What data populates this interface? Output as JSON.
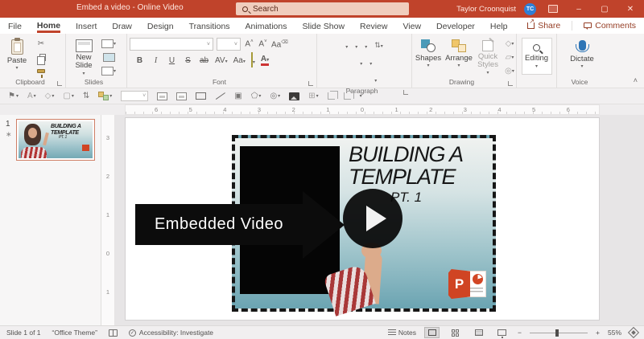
{
  "titlebar": {
    "title": "Embed a video - Online Video",
    "search_label": "Search",
    "user_name": "Taylor Croonquist",
    "user_initials": "TC"
  },
  "tabs": {
    "items": [
      "File",
      "Home",
      "Insert",
      "Draw",
      "Design",
      "Transitions",
      "Animations",
      "Slide Show",
      "Review",
      "View",
      "Developer",
      "Help"
    ],
    "active": "Home",
    "share": "Share",
    "comments": "Comments"
  },
  "ribbon": {
    "paste": "Paste",
    "clipboard_group": "Clipboard",
    "new_slide": "New Slide",
    "slides_group": "Slides",
    "font_name": "",
    "font_size": "",
    "bold": "B",
    "italic": "I",
    "underline": "U",
    "strike": "S",
    "strike_ab": "ab",
    "size_up": "A",
    "size_down": "A",
    "clear": "Aa",
    "spacing": "AV",
    "case": "Aa",
    "font_group": "Font",
    "paragraph_group": "Paragraph",
    "shapes": "Shapes",
    "arrange": "Arrange",
    "quick_styles": "Quick Styles",
    "drawing_group": "Drawing",
    "editing": "Editing",
    "dictate": "Dictate",
    "voice_group": "Voice"
  },
  "ruler": {
    "h": [
      "6",
      "5",
      "4",
      "3",
      "2",
      "1",
      "0",
      "1",
      "2",
      "3",
      "4",
      "5",
      "6"
    ],
    "v": [
      "3",
      "2",
      "1",
      "0",
      "1"
    ]
  },
  "thumbnail": {
    "number": "1",
    "star": "∗"
  },
  "slide": {
    "video": {
      "title1": "BUILDING A",
      "title2": "TEMPLATE",
      "subtitle": "PT. 1",
      "logo_letter": "P"
    }
  },
  "callout": {
    "label": "Embedded Video"
  },
  "statusbar": {
    "slide_info": "Slide 1 of 1",
    "theme": "“Office Theme”",
    "accessibility": "Accessibility: Investigate",
    "notes": "Notes",
    "zoom_minus": "−",
    "zoom_plus": "+",
    "zoom_level": "55%"
  }
}
